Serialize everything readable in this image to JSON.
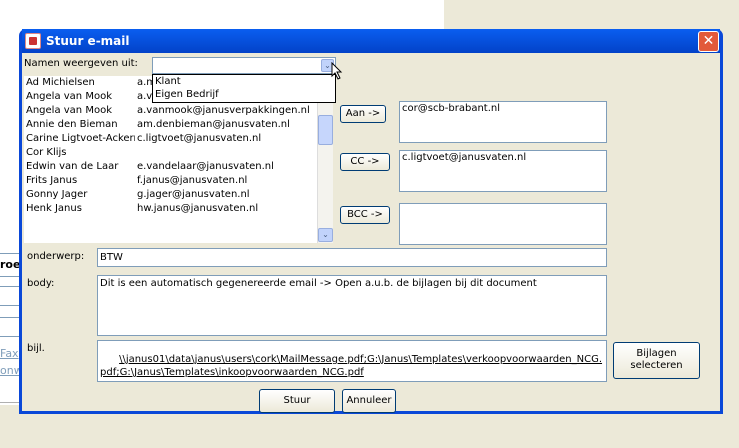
{
  "background": {
    "fragment_top": "roe",
    "fragment_links": [
      "Fax",
      "onw"
    ]
  },
  "window": {
    "title": "Stuur e-mail",
    "close_glyph": "✕"
  },
  "form": {
    "names_label": "Namen weergeven uit:",
    "combo_value": "",
    "combo_arrow": "⌄",
    "dropdown_options": [
      "Klant",
      "Eigen Bedrijf"
    ],
    "contacts": [
      {
        "name": "Ad  Michielsen",
        "email": "a.m"
      },
      {
        "name": "Angela van Mook",
        "email": "a.v"
      },
      {
        "name": "Angela van Mook",
        "email": "a.vanmook@janusverpakkingen.nl"
      },
      {
        "name": "Annie den Bieman",
        "email": "am.denbieman@janusvaten.nl"
      },
      {
        "name": "Carine  Ligtvoet-Ackerm",
        "email": "c.ligtvoet@janusvaten.nl"
      },
      {
        "name": "Cor  Klijs",
        "email": ""
      },
      {
        "name": "Edwin van de Laar",
        "email": "e.vandelaar@janusvaten.nl"
      },
      {
        "name": "Frits  Janus",
        "email": "f.janus@janusvaten.nl"
      },
      {
        "name": "Gonny  Jager",
        "email": "g.jager@janusvaten.nl"
      },
      {
        "name": "Henk  Janus",
        "email": "hw.janus@janusvaten.nl"
      }
    ],
    "to_button": "Aan ->",
    "to_value": "cor@scb-brabant.nl",
    "cc_button": "CC ->",
    "cc_value": "c.ligtvoet@janusvaten.nl",
    "bcc_button": "BCC ->",
    "bcc_value": "",
    "subject_label": "onderwerp:",
    "subject_value": "BTW",
    "body_label": "body:",
    "body_value": "Dit is een automatisch gegenereerde email -> Open a.u.b. de bijlagen bij dit document",
    "attach_label": "bijl.",
    "attach_value": "\\\\janus01\\data\\janus\\users\\cork\\MailMessage.pdf;G:\\Janus\\Templates\\verkoopvoorwaarden_NCG.pdf;G:\\Janus\\Templates\\inkoopvoorwaarden_NCG.pdf",
    "attach_button": "Bijlagen selecteren",
    "send_button": "Stuur",
    "cancel_button": "Annuleer"
  }
}
